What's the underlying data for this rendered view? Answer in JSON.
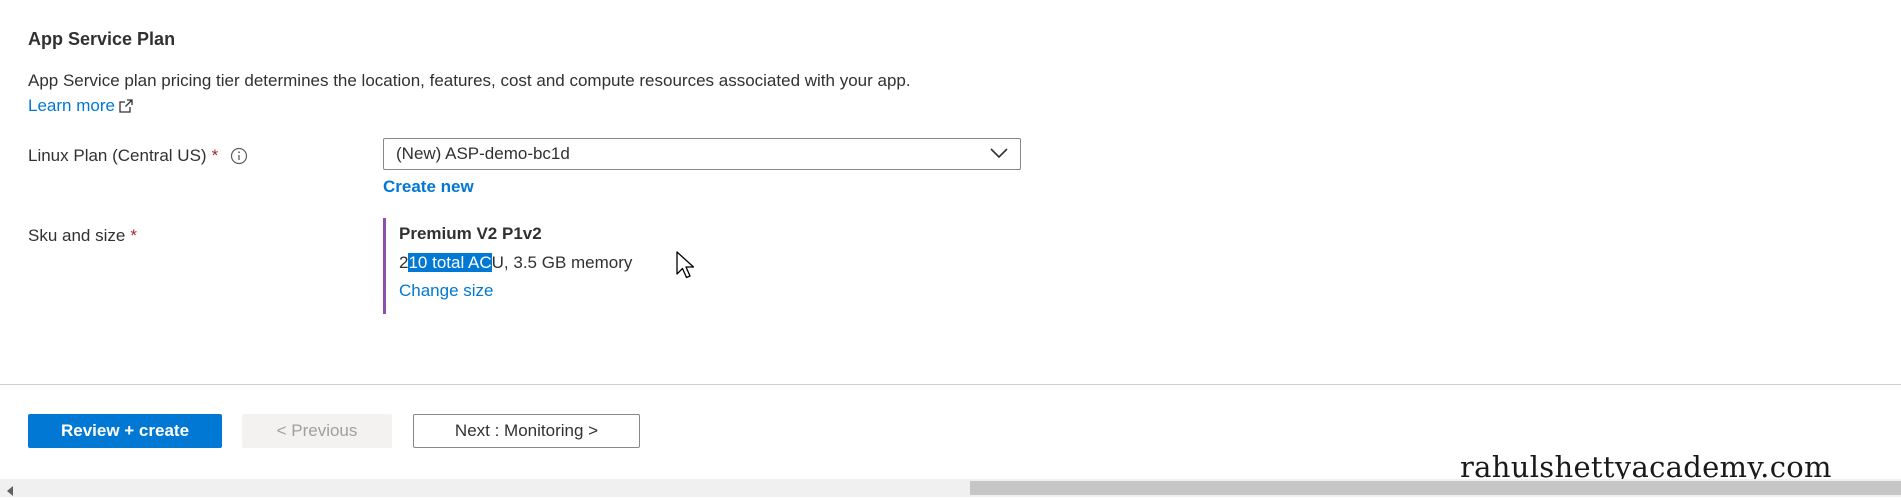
{
  "section": {
    "title": "App Service Plan",
    "description": "App Service plan pricing tier determines the location, features, cost and compute resources associated with your app.",
    "learn_more": "Learn more",
    "learn_more_icon": "external-link-icon"
  },
  "plan": {
    "label": "Linux Plan (Central US)",
    "required": "*",
    "info_icon": "info-icon",
    "selected_value": "(New) ASP-demo-bc1d",
    "chevron_icon": "chevron-down-icon",
    "create_new": "Create new"
  },
  "sku": {
    "label": "Sku and size",
    "required": "*",
    "name": "Premium V2 P1v2",
    "detail_pre": "2",
    "detail_selected": "10 total AC",
    "detail_post": "U, 3.5 GB memory",
    "change_size": "Change size",
    "accent_color": "#8c4fb0"
  },
  "footer": {
    "review_create": "Review + create",
    "previous": "< Previous",
    "next": "Next : Monitoring >"
  },
  "watermark": "rahulshettyacademy.com",
  "colors": {
    "primary": "#0078d4",
    "required": "#a4262c",
    "text": "#323130"
  }
}
